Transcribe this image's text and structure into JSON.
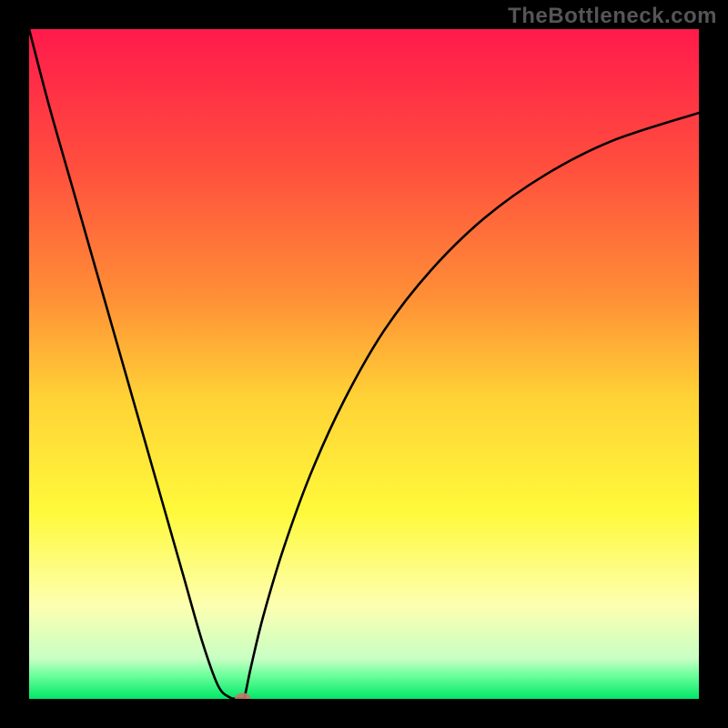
{
  "watermark": "TheBottleneck.com",
  "chart_data": {
    "type": "line",
    "title": "",
    "xlabel": "",
    "ylabel": "",
    "xlim": [
      0,
      100
    ],
    "ylim": [
      0,
      100
    ],
    "grid": false,
    "background_gradient": {
      "type": "vertical",
      "stops": [
        {
          "pos": 0.0,
          "color": "#ff1a4b"
        },
        {
          "pos": 0.2,
          "color": "#ff4d3e"
        },
        {
          "pos": 0.4,
          "color": "#ff8f36"
        },
        {
          "pos": 0.55,
          "color": "#ffd236"
        },
        {
          "pos": 0.72,
          "color": "#fff93a"
        },
        {
          "pos": 0.86,
          "color": "#fdffb0"
        },
        {
          "pos": 0.94,
          "color": "#c8ffc4"
        },
        {
          "pos": 0.965,
          "color": "#6dff9a"
        },
        {
          "pos": 1.0,
          "color": "#00e867"
        }
      ]
    },
    "series": [
      {
        "name": "bottleneck-curve",
        "color": "#000000",
        "x": [
          0,
          3,
          7,
          11,
          14,
          17,
          20,
          23,
          25.8,
          28.2,
          30,
          31.3,
          31.9,
          32.1,
          32.4,
          33.2,
          35,
          38,
          42,
          47,
          53,
          60,
          68,
          77,
          87,
          100
        ],
        "y": [
          100,
          88.5,
          74.5,
          60.5,
          50,
          39.5,
          29,
          18.5,
          8.7,
          2.0,
          0.2,
          0.05,
          0,
          0.05,
          1.3,
          5.1,
          12.5,
          22.5,
          33.5,
          44.5,
          55,
          64,
          71.8,
          78.2,
          83.3,
          87.5
        ]
      }
    ],
    "marker": {
      "name": "optimum-point",
      "x": 31.9,
      "y": 0,
      "shape": "ellipse",
      "rx_pct": 1.2,
      "ry_pct": 0.9,
      "fill": "#c27a6a",
      "fill_opacity": 0.9
    }
  }
}
